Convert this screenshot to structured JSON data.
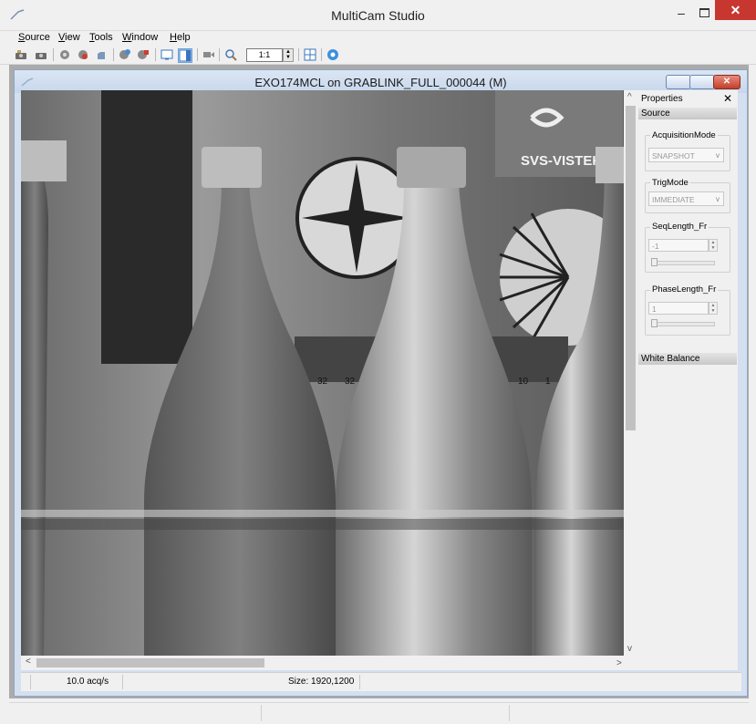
{
  "app": {
    "title": "MultiCam Studio"
  },
  "menu": [
    "Source",
    "View",
    "Tools",
    "Window",
    "Help"
  ],
  "toolbar": {
    "zoom_value": "1:1"
  },
  "child": {
    "title": "EXO174MCL on GRABLINK_FULL_000044 (M)"
  },
  "image": {
    "description_labels": [
      "SVS-VISTEK",
      "32",
      "32",
      "10",
      "1"
    ]
  },
  "status": {
    "rate": "10.0 acq/s",
    "size": "Size: 1920,1200"
  },
  "properties": {
    "title": "Properties",
    "close": "✕",
    "source_section": "Source",
    "acquisition_mode": {
      "label": "AcquisitionMode",
      "value": "SNAPSHOT"
    },
    "trig_mode": {
      "label": "TrigMode",
      "value": "IMMEDIATE"
    },
    "seq_length": {
      "label": "SeqLength_Fr",
      "value": "-1",
      "slider_fraction": 0
    },
    "phase_length": {
      "label": "PhaseLength_Fr",
      "value": "1",
      "slider_fraction": 0
    },
    "white_balance_section": "White Balance"
  },
  "colors": {
    "close_red": "#c7372f",
    "child_title": "#c7d7ec"
  },
  "icons": [
    "camera-icon",
    "camera-open-icon",
    "settings-icon",
    "record-icon",
    "hand-icon",
    "refresh-icon",
    "stop-icon",
    "display-icon",
    "panel-icon",
    "video-icon",
    "zoom-in-icon",
    "zoom-out-icon",
    "grid-icon",
    "help-icon"
  ]
}
